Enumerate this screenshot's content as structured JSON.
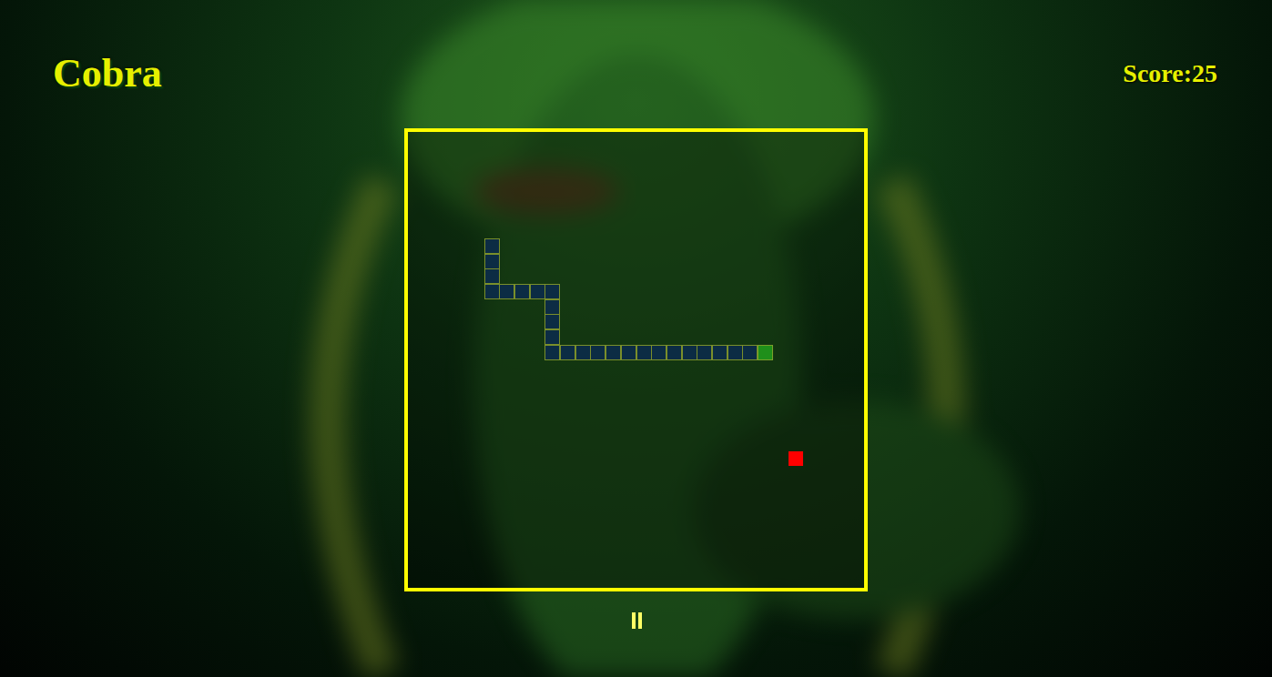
{
  "header": {
    "title": "Cobra",
    "score": "Score:25"
  },
  "board": {
    "cols": 30,
    "rows": 30,
    "snake": [
      {
        "col": 5,
        "row": 7,
        "head": false
      },
      {
        "col": 5,
        "row": 8,
        "head": false
      },
      {
        "col": 5,
        "row": 9,
        "head": false
      },
      {
        "col": 5,
        "row": 10,
        "head": false
      },
      {
        "col": 6,
        "row": 10,
        "head": false
      },
      {
        "col": 7,
        "row": 10,
        "head": false
      },
      {
        "col": 8,
        "row": 10,
        "head": false
      },
      {
        "col": 9,
        "row": 10,
        "head": false
      },
      {
        "col": 9,
        "row": 11,
        "head": false
      },
      {
        "col": 9,
        "row": 12,
        "head": false
      },
      {
        "col": 9,
        "row": 13,
        "head": false
      },
      {
        "col": 9,
        "row": 14,
        "head": false
      },
      {
        "col": 10,
        "row": 14,
        "head": false
      },
      {
        "col": 11,
        "row": 14,
        "head": false
      },
      {
        "col": 12,
        "row": 14,
        "head": false
      },
      {
        "col": 13,
        "row": 14,
        "head": false
      },
      {
        "col": 14,
        "row": 14,
        "head": false
      },
      {
        "col": 15,
        "row": 14,
        "head": false
      },
      {
        "col": 16,
        "row": 14,
        "head": false
      },
      {
        "col": 17,
        "row": 14,
        "head": false
      },
      {
        "col": 18,
        "row": 14,
        "head": false
      },
      {
        "col": 19,
        "row": 14,
        "head": false
      },
      {
        "col": 20,
        "row": 14,
        "head": false
      },
      {
        "col": 21,
        "row": 14,
        "head": false
      },
      {
        "col": 22,
        "row": 14,
        "head": false
      },
      {
        "col": 23,
        "row": 14,
        "head": true
      }
    ],
    "food": {
      "col": 25,
      "row": 21
    }
  },
  "paused": false
}
